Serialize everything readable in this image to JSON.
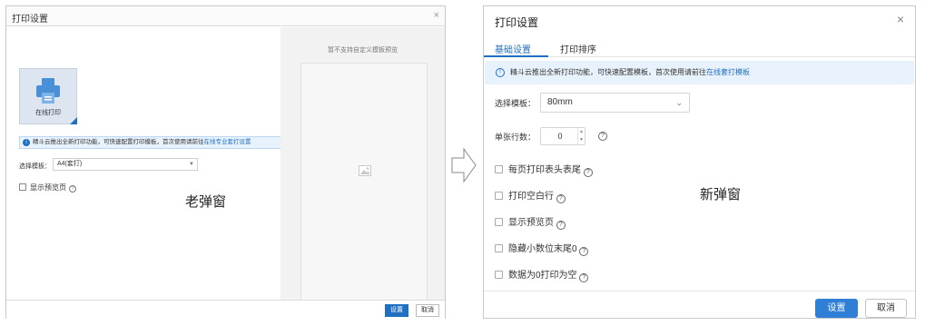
{
  "old_dialog": {
    "title": "打印设置",
    "close": "×",
    "tile_label": "在线打印",
    "notice_text": "精斗云推出全新打印功能，可快速配置打印模板，首次使用请前往",
    "notice_link": "在线专业套打设置",
    "template_label": "选择模板：",
    "template_value": "A4(套打)",
    "preview_checkbox_label": "显示预览页",
    "caption": "老弹窗",
    "preview_title": "暂不支持自定义模板预览",
    "set_button": "设置",
    "cancel_button": "取消"
  },
  "new_dialog": {
    "title": "打印设置",
    "close": "×",
    "tabs": [
      {
        "label": "基础设置",
        "active": true
      },
      {
        "label": "打印排序",
        "active": false
      }
    ],
    "notice_text": "精斗云推出全新打印功能，可快速配置模板，首次使用请前往",
    "notice_link": "在线套打模板",
    "template_label": "选择模板：",
    "template_value": "80mm",
    "rows_label": "单张行数：",
    "rows_value": "0",
    "checkboxes": [
      {
        "label": "每页打印表头表尾",
        "checked": false
      },
      {
        "label": "打印空白行",
        "checked": false
      },
      {
        "label": "显示预览页",
        "checked": false
      },
      {
        "label": "隐藏小数位末尾0",
        "checked": false
      },
      {
        "label": "数据为0打印为空",
        "checked": false
      }
    ],
    "caption": "新弹窗",
    "set_button": "设置",
    "cancel_button": "取消"
  },
  "colors": {
    "accent": "#1f6fc2",
    "primary_button": "#2f7fd6",
    "notice_bg": "#e8f2fc"
  }
}
